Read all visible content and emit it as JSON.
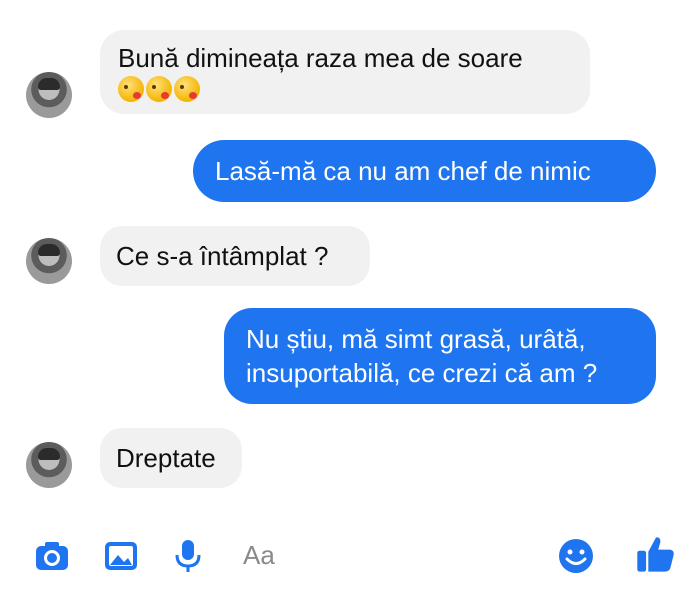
{
  "messages": [
    {
      "direction": "in",
      "text": "Bună dimineața raza mea de soare",
      "emoji_count": 3,
      "emoji": "kiss-face-emoji"
    },
    {
      "direction": "out",
      "text": "Lasă-mă ca nu am chef de nimic"
    },
    {
      "direction": "in",
      "text": "Ce s-a întâmplat  ?"
    },
    {
      "direction": "out",
      "line1": "Nu știu, mă simt grasă, urâtă,",
      "line2": "insuportabilă, ce crezi că am ?"
    },
    {
      "direction": "in",
      "text": "Dreptate"
    }
  ],
  "composer": {
    "placeholder": "Aa",
    "icons": [
      "camera-icon",
      "image-icon",
      "microphone-icon",
      "emoji-icon",
      "thumbs-up-icon"
    ]
  },
  "colors": {
    "accent": "#1f74f0",
    "incoming_bubble": "#f1f1f1",
    "background": "#ffffff"
  }
}
